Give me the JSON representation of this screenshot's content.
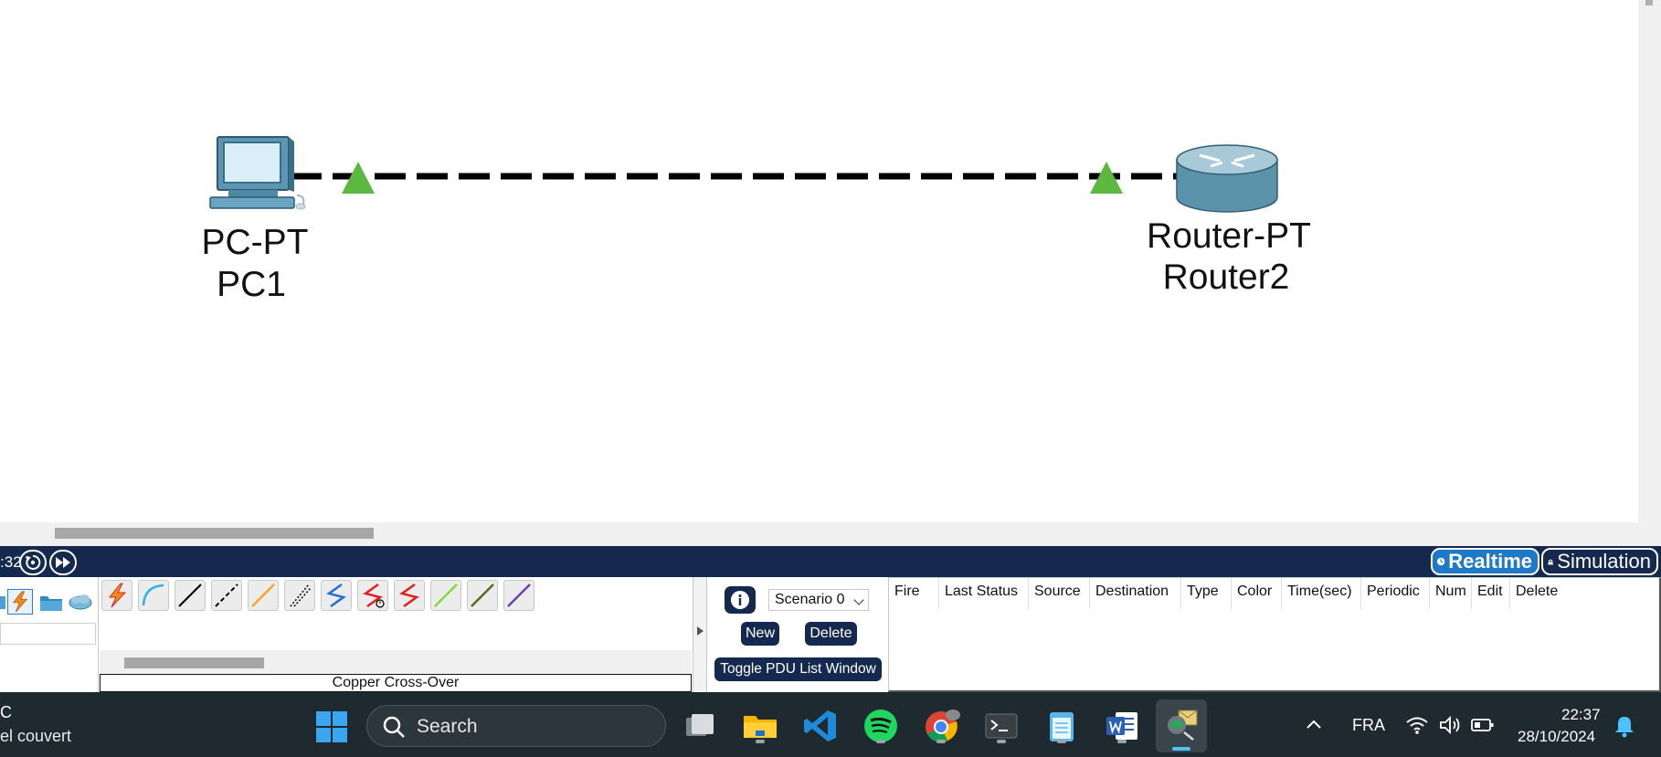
{
  "workspace": {
    "devices": [
      {
        "model": "PC-PT",
        "name": "PC1"
      },
      {
        "model": "Router-PT",
        "name": "Router2"
      }
    ],
    "link": {
      "type": "dashed",
      "status_color": "#5cb841"
    }
  },
  "statusbar": {
    "time_fragment": ":32",
    "realtime_label": "Realtime",
    "simulation_label": "Simulation"
  },
  "connections": {
    "caption": "Copper Cross-Over",
    "icons": [
      "automatic-lightning-icon",
      "console-cable-icon",
      "copper-straight-icon",
      "copper-crossover-icon",
      "fiber-icon",
      "phone-cable-icon",
      "coaxial-icon",
      "serial-dce-icon",
      "serial-dte-icon",
      "octal-icon",
      "iot-cable-icon",
      "usb-cable-icon"
    ]
  },
  "scenario": {
    "selected": "Scenario 0",
    "new_label": "New",
    "delete_label": "Delete",
    "toggle_label": "Toggle PDU List Window"
  },
  "pdu_table": {
    "columns": [
      "Fire",
      "Last Status",
      "Source",
      "Destination",
      "Type",
      "Color",
      "Time(sec)",
      "Periodic",
      "Num",
      "Edit",
      "Delete"
    ]
  },
  "taskbar": {
    "weather_line1": "C",
    "weather_line2": "el couvert",
    "search_placeholder": "Search",
    "language": "FRA",
    "time": "22:37",
    "date": "28/10/2024"
  },
  "colors": {
    "status_bar": "#14294d",
    "realtime_accent": "#1e79c8",
    "taskbar": "#1f2a30"
  }
}
